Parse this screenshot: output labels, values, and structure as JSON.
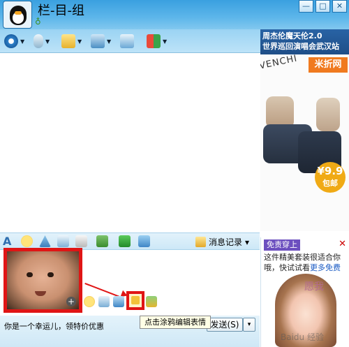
{
  "window": {
    "title": "栏-目-组",
    "controls": [
      "—",
      "□",
      "✕"
    ]
  },
  "toolbar": {
    "items": [
      "video-call",
      "voice-call",
      "send-file",
      "remote-assist",
      "share-screen",
      "apps"
    ]
  },
  "ads": {
    "top_banner": {
      "line1": "周杰伦魔天伦2.0",
      "line2": "世界巡回演唱会武汉站",
      "brand": "VENCHI",
      "tag": "米折网",
      "price": "¥9.9",
      "price_tag": "包邮"
    },
    "bottom": {
      "tag": "免责穿上",
      "close": "✕",
      "text": "这件精美套装很适合你哦，快试试看",
      "link": "更多免费",
      "overlay": "愿我"
    }
  },
  "input_toolbar": {
    "message_history_label": "消息记录",
    "dropdown": "▾"
  },
  "input": {
    "tooltip": "点击涂鸦编辑表情",
    "zoom": "+"
  },
  "bottom_bar": {
    "text": "你是一个幸运儿，领特价优惠",
    "send_label": "发送(S)",
    "send_arrow": "▾"
  },
  "watermark": "Baidu 经验"
}
